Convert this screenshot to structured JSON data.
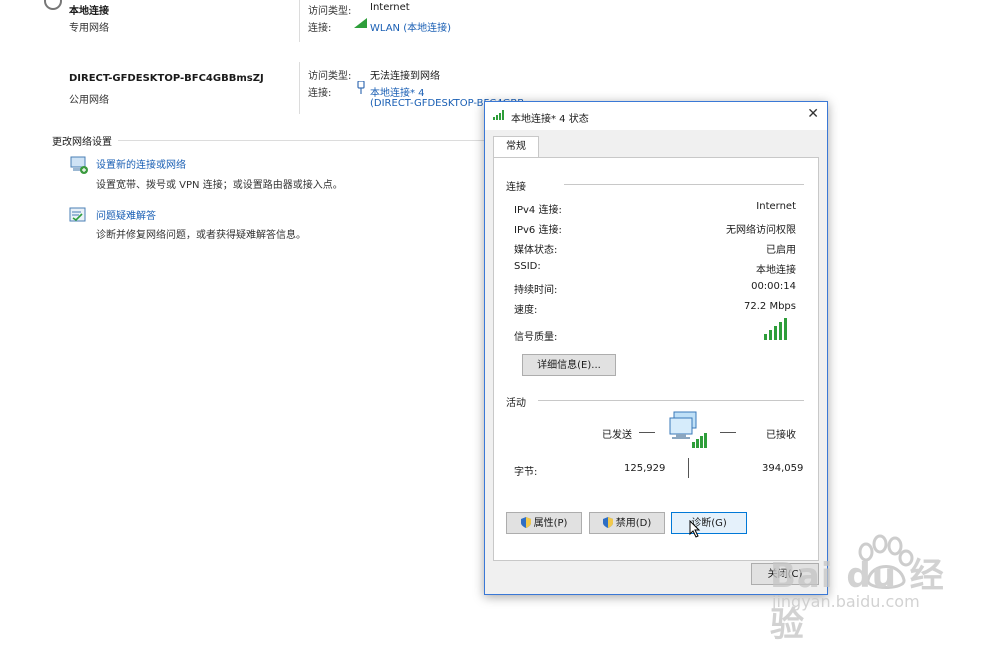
{
  "networks": [
    {
      "name": "本地连接",
      "type": "专用网络",
      "access_label": "访问类型:",
      "access_value": "Internet",
      "conn_label": "连接:",
      "conn_value": "WLAN (本地连接)"
    },
    {
      "name": "DIRECT-GFDESKTOP-BFC4GBBmsZJ",
      "type": "公用网络",
      "access_label": "访问类型:",
      "access_value": "无法连接到网络",
      "conn_label": "连接:",
      "conn_value_line1": "本地连接* 4",
      "conn_value_line2": "(DIRECT-GFDESKTOP-BFC4GBB"
    }
  ],
  "change_settings": {
    "heading": "更改网络设置",
    "items": [
      {
        "title": "设置新的连接或网络",
        "desc": "设置宽带、拨号或 VPN 连接；或设置路由器或接入点。",
        "icon": "network-setup-icon"
      },
      {
        "title": "问题疑难解答",
        "desc": "诊断并修复网络问题，或者获得疑难解答信息。",
        "icon": "troubleshoot-icon"
      }
    ]
  },
  "dialog": {
    "title": "本地连接* 4 状态",
    "tab": "常规",
    "connection_heading": "连接",
    "rows": [
      {
        "label": "IPv4 连接:",
        "value": "Internet"
      },
      {
        "label": "IPv6 连接:",
        "value": "无网络访问权限"
      },
      {
        "label": "媒体状态:",
        "value": "已启用"
      },
      {
        "label": "SSID:",
        "value": "本地连接"
      },
      {
        "label": "持续时间:",
        "value": "00:00:14"
      },
      {
        "label": "速度:",
        "value": "72.2 Mbps"
      }
    ],
    "signal_label": "信号质量:",
    "details_button": "详细信息(E)...",
    "activity_heading": "活动",
    "sent_label": "已发送",
    "received_label": "已接收",
    "bytes_label": "字节:",
    "bytes_sent": "125,929",
    "bytes_received": "394,059",
    "properties_button": "属性(P)",
    "disable_button": "禁用(D)",
    "diagnose_button": "诊断(G)",
    "close_button": "关闭(C)"
  },
  "colors": {
    "link": "#1a5fb4",
    "signal": "#2e9e3a",
    "dialog_border": "#3a78d6"
  },
  "watermark": {
    "brand": "Bai du 经验",
    "url": "jingyan.baidu.com"
  }
}
